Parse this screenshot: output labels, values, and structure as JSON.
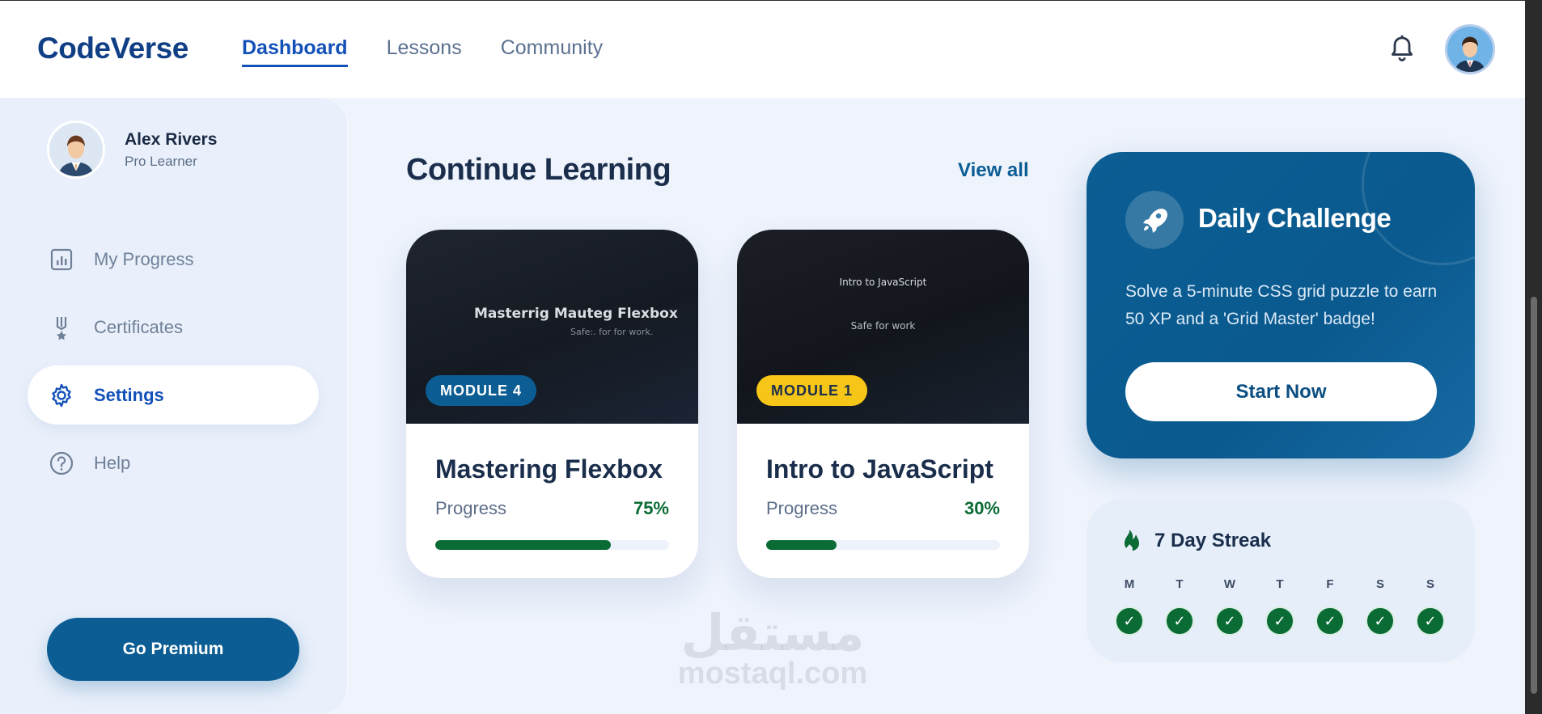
{
  "brand": "CodeVerse",
  "nav": {
    "items": [
      {
        "label": "Dashboard",
        "active": true
      },
      {
        "label": "Lessons",
        "active": false
      },
      {
        "label": "Community",
        "active": false
      }
    ]
  },
  "icons": {
    "notifications": "bell-icon",
    "avatar": "user-avatar-icon"
  },
  "sidebar": {
    "profile": {
      "name": "Alex Rivers",
      "role": "Pro Learner"
    },
    "items": [
      {
        "label": "My Progress",
        "icon": "chart-icon",
        "active": false
      },
      {
        "label": "Certificates",
        "icon": "medal-icon",
        "active": false
      },
      {
        "label": "Settings",
        "icon": "gear-icon",
        "active": true
      },
      {
        "label": "Help",
        "icon": "help-icon",
        "active": false
      }
    ],
    "premium_label": "Go Premium"
  },
  "main": {
    "section_title": "Continue Learning",
    "view_all": "View all",
    "courses": [
      {
        "badge": "MODULE 4",
        "badge_bg": "#0b5d93",
        "badge_color": "#ffffff",
        "thumb_title": "Masterrig Mauteg Flexbox",
        "thumb_sub": "Safe:. for for work.",
        "title": "Mastering Flexbox",
        "progress_label": "Progress",
        "progress_text": "75%",
        "progress": 0.75
      },
      {
        "badge": "MODULE 1",
        "badge_bg": "#f5c518",
        "badge_color": "#1a2e4c",
        "thumb_title": "Intro to JavaScript",
        "thumb_sub": "Safe for work",
        "title": "Intro to JavaScript",
        "progress_label": "Progress",
        "progress_text": "30%",
        "progress": 0.3
      }
    ]
  },
  "challenge": {
    "title": "Daily Challenge",
    "icon": "rocket-icon",
    "description": "Solve a 5-minute CSS grid puzzle to earn 50 XP and a 'Grid Master' badge!",
    "button": "Start Now"
  },
  "streak": {
    "title": "7 Day Streak",
    "icon": "flame-icon",
    "days": [
      "M",
      "T",
      "W",
      "T",
      "F",
      "S",
      "S"
    ],
    "check": "✓"
  },
  "watermark": {
    "arabic": "مستقل",
    "latin": "mostaql.com"
  },
  "colors": {
    "brand": "#113f86",
    "accent": "#1351b9",
    "primary": "#0b5d93",
    "success": "#0a6b35",
    "highlight": "#f5c518"
  }
}
